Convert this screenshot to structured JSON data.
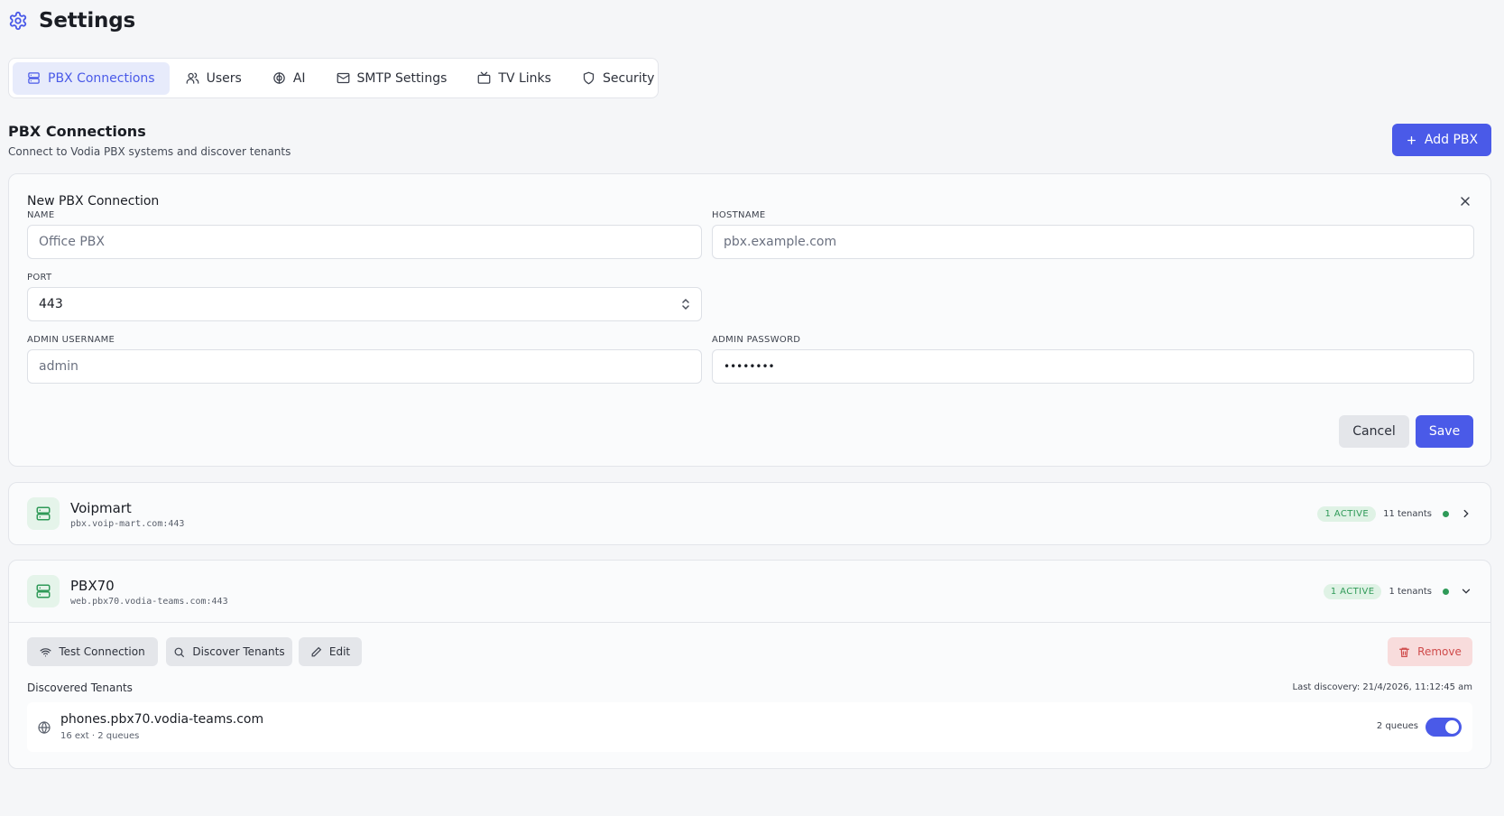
{
  "page": {
    "title": "Settings",
    "icon": "gear-icon"
  },
  "tabs": [
    {
      "label": "PBX Connections",
      "icon": "server-icon",
      "active": true
    },
    {
      "label": "Users",
      "icon": "users-icon",
      "active": false
    },
    {
      "label": "AI",
      "icon": "brain-icon",
      "active": false
    },
    {
      "label": "SMTP Settings",
      "icon": "mail-icon",
      "active": false
    },
    {
      "label": "TV Links",
      "icon": "tv-icon",
      "active": false
    },
    {
      "label": "Security",
      "icon": "shield-icon",
      "active": false
    }
  ],
  "section": {
    "title": "PBX Connections",
    "subtitle": "Connect to Vodia PBX systems and discover tenants",
    "add_label": "Add PBX"
  },
  "form": {
    "heading": "New PBX Connection",
    "name": {
      "label": "NAME",
      "placeholder": "Office PBX",
      "value": ""
    },
    "hostname": {
      "label": "HOSTNAME",
      "placeholder": "pbx.example.com",
      "value": ""
    },
    "port": {
      "label": "PORT",
      "value": "443"
    },
    "admin_username": {
      "label": "ADMIN USERNAME",
      "placeholder": "admin",
      "value": ""
    },
    "admin_password": {
      "label": "ADMIN PASSWORD",
      "value": "••••••••"
    },
    "cancel_label": "Cancel",
    "save_label": "Save"
  },
  "pbx_list": [
    {
      "name": "Voipmart",
      "host": "pbx.voip-mart.com:443",
      "badge": "1 ACTIVE",
      "tenants": "11 tenants",
      "expanded": false
    },
    {
      "name": "PBX70",
      "host": "web.pbx70.vodia-teams.com:443",
      "badge": "1 ACTIVE",
      "tenants": "1 tenants",
      "expanded": true,
      "actions": {
        "test": "Test Connection",
        "discover": "Discover Tenants",
        "edit": "Edit",
        "remove": "Remove"
      },
      "discovered_title": "Discovered Tenants",
      "last_discovery": "Last discovery: 21/4/2026, 11:12:45 am",
      "tenant_list": [
        {
          "host": "phones.pbx70.vodia-teams.com",
          "meta": "16 ext · 2 queues",
          "queues": "2 queues",
          "enabled": true
        }
      ]
    }
  ],
  "colors": {
    "accent": "#4a5ae8",
    "success": "#2f9a58",
    "danger": "#cf4b4b"
  }
}
